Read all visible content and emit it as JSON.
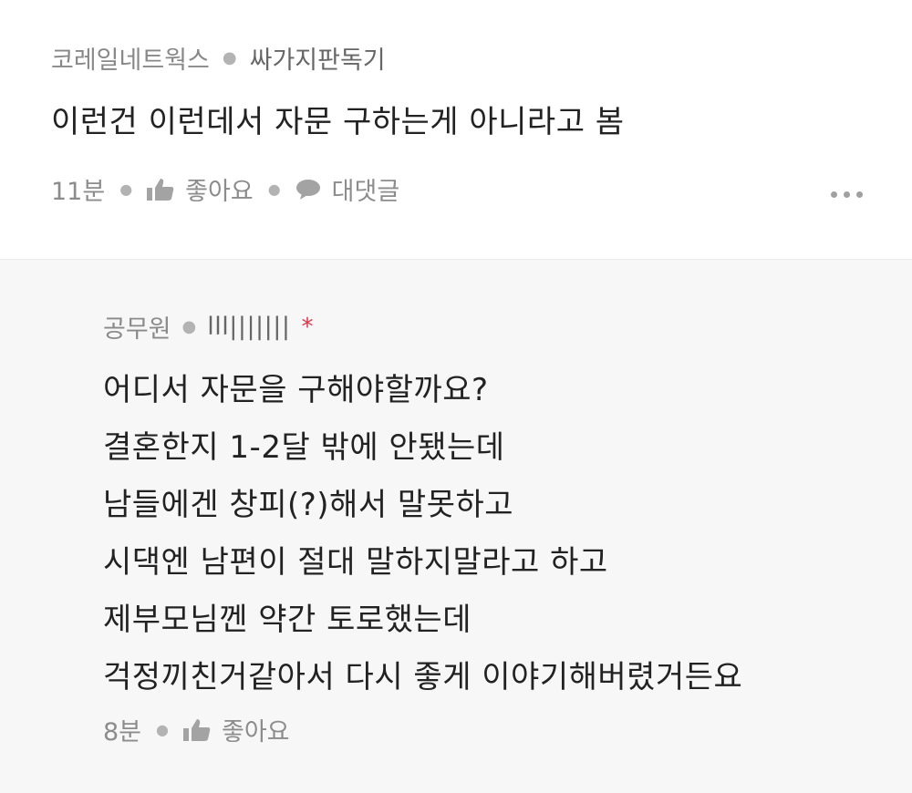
{
  "comment": {
    "author": "코레일네트웍스",
    "nickname": "싸가지판독기",
    "text": "이런건 이런데서 자문 구하는게 아니라고 봄",
    "time": "11분",
    "like_label": "좋아요",
    "reply_label": "대댓글",
    "icons": {
      "like": "thumbs-up-icon",
      "reply": "speech-bubble-icon",
      "more": "more-dots-icon"
    }
  },
  "reply": {
    "author": "공무원",
    "nickname": "lll|||||||",
    "badge": "*",
    "lines": [
      "어디서 자문을 구해야할까요?",
      "결혼한지 1-2달 밖에 안됐는데",
      "남들에겐 창피(?)해서 말못하고",
      "시댁엔 남편이 절대 말하지말라고 하고",
      "제부모님껜 약간 토로했는데",
      "걱정끼친거같아서 다시 좋게 이야기해버렸거든요"
    ],
    "time": "8분",
    "like_label": "좋아요"
  },
  "colors": {
    "reply_background": "#f7f7f7",
    "text": "#222222",
    "meta": "#888888",
    "badge": "#e0344b"
  }
}
